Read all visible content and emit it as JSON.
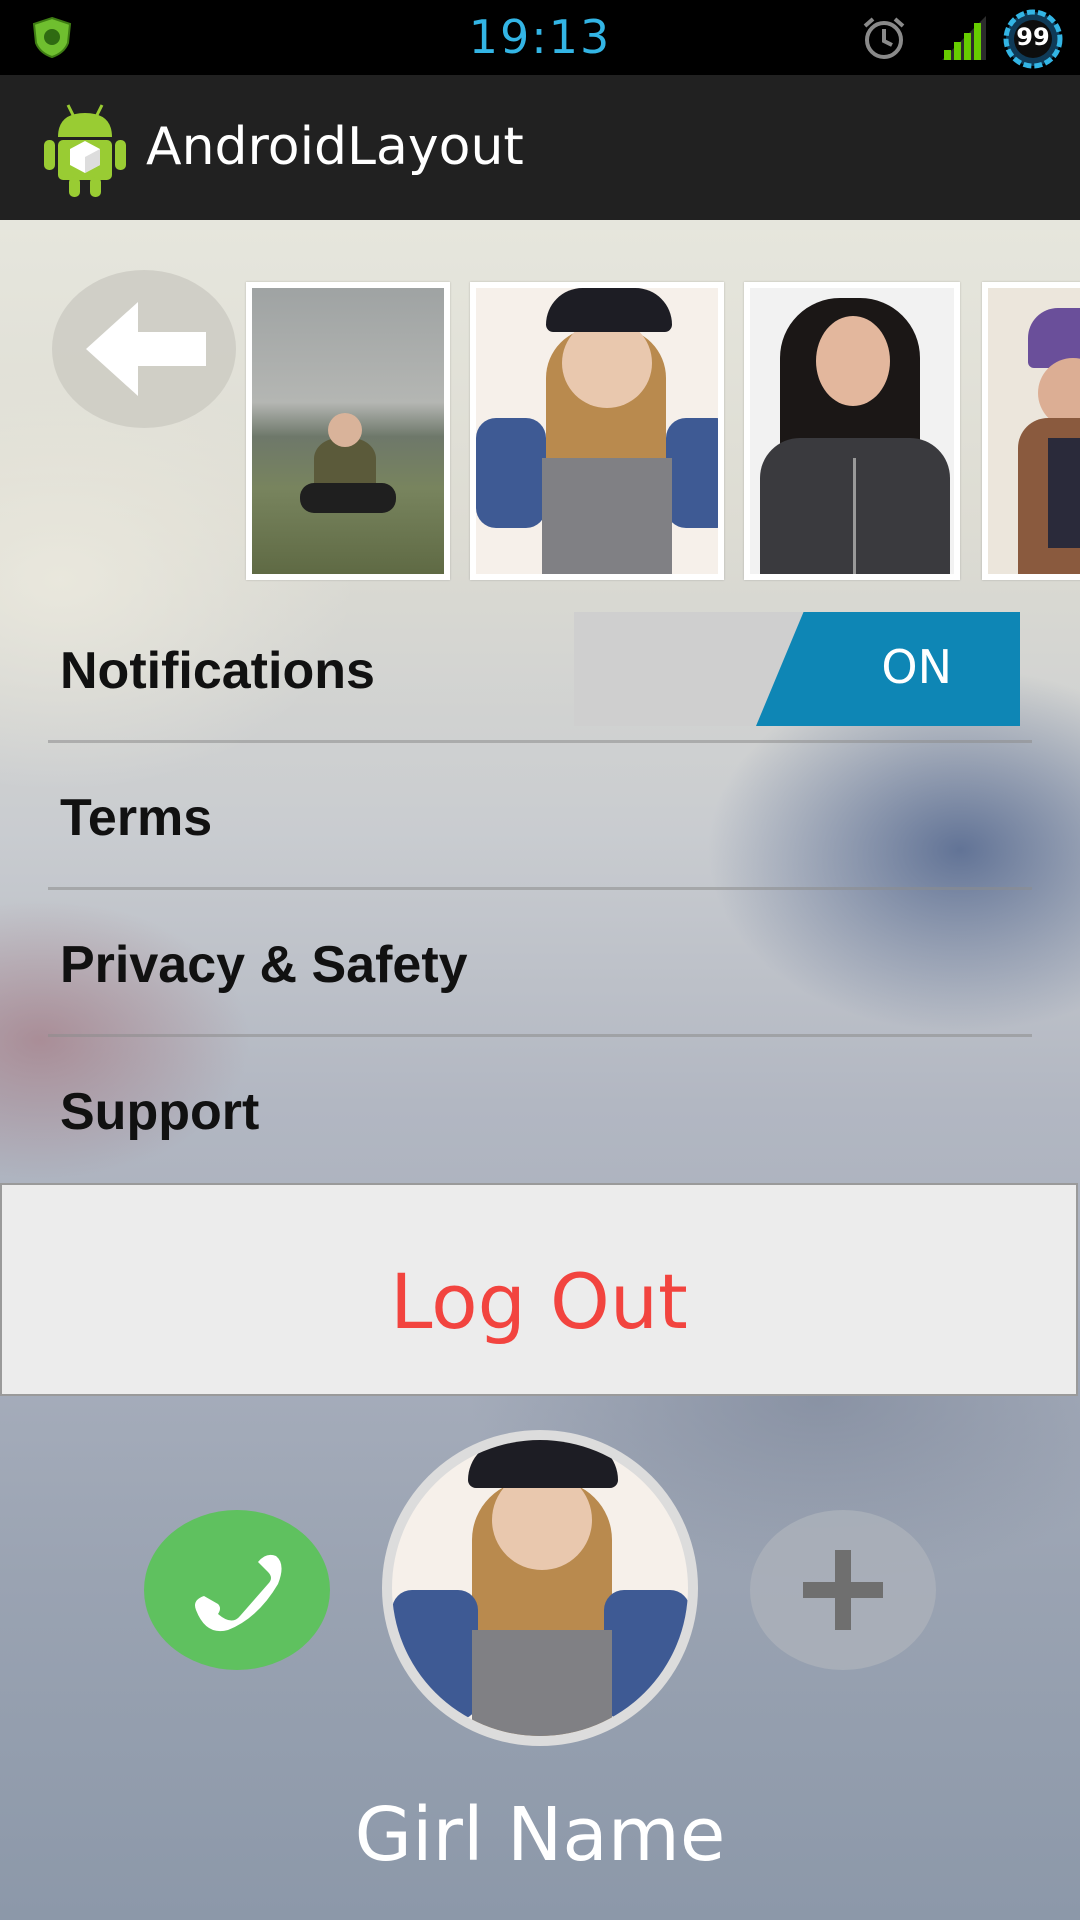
{
  "status_bar": {
    "time": "19:13",
    "battery_level": "99",
    "icons": [
      "shield-icon",
      "alarm-icon",
      "signal-icon",
      "battery-icon"
    ]
  },
  "action_bar": {
    "title": "AndroidLayout",
    "logo_icon": "android-logo-icon"
  },
  "photo_strip": {
    "back_icon": "arrow-left-icon",
    "photos": [
      "photo-1",
      "photo-2",
      "photo-3",
      "photo-4"
    ]
  },
  "settings": {
    "notifications_label": "Notifications",
    "notifications_toggle": "ON",
    "terms_label": "Terms",
    "privacy_label": "Privacy & Safety",
    "support_label": "Support"
  },
  "logout_label": "Log Out",
  "profile": {
    "name": "Girl Name",
    "call_icon": "phone-icon",
    "add_icon": "plus-icon"
  },
  "colors": {
    "accent_blue": "#0e86b5",
    "logout_red": "#f2443f",
    "call_green": "#5fc15f",
    "status_time": "#33b5e5"
  }
}
